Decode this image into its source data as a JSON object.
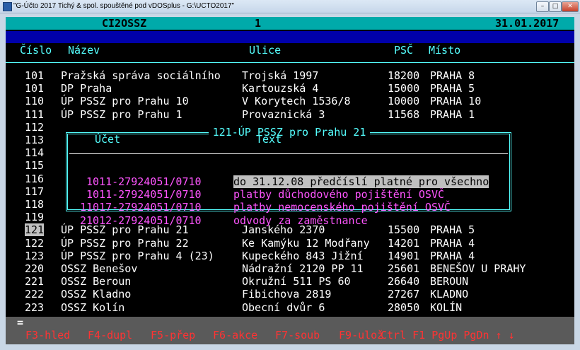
{
  "window": {
    "title": "\"G-Účto 2017 Tichý & spol. spouštěné pod vDOSplus - G:\\UCTO2017\""
  },
  "header": {
    "module": "CI2OSSZ",
    "page": "1",
    "date": "31.01.2017"
  },
  "columns": {
    "cislo": "Číslo",
    "nazev": "Název",
    "ulice": "Ulice",
    "psc": "PSČ",
    "misto": "Místo"
  },
  "rows": [
    {
      "cislo": "101",
      "nazev": "Pražská správa sociálního",
      "ulice": "Trojská 1997",
      "psc": "18200",
      "misto": "PRAHA 8"
    },
    {
      "cislo": "101",
      "nazev": "DP Praha",
      "ulice": "Kartouzská 4",
      "psc": "15000",
      "misto": "PRAHA 5"
    },
    {
      "cislo": "110",
      "nazev": "ÚP PSSZ pro Prahu 10",
      "ulice": "V Korytech 1536/8",
      "psc": "10000",
      "misto": "PRAHA 10"
    },
    {
      "cislo": "111",
      "nazev": "ÚP PSSZ pro Prahu 1",
      "ulice": "Provaznická 3",
      "psc": "11568",
      "misto": "PRAHA 1"
    },
    {
      "cislo": "112",
      "nazev": "",
      "ulice": "",
      "psc": "",
      "misto": ""
    },
    {
      "cislo": "113",
      "nazev": "",
      "ulice": "",
      "psc": "",
      "misto": ""
    },
    {
      "cislo": "114",
      "nazev": "",
      "ulice": "",
      "psc": "",
      "misto": ""
    },
    {
      "cislo": "115",
      "nazev": "",
      "ulice": "",
      "psc": "",
      "misto": ""
    },
    {
      "cislo": "116",
      "nazev": "",
      "ulice": "",
      "psc": "",
      "misto": ""
    },
    {
      "cislo": "117",
      "nazev": "",
      "ulice": "",
      "psc": "",
      "misto": ""
    },
    {
      "cislo": "118",
      "nazev": "",
      "ulice": "",
      "psc": "",
      "misto": ""
    },
    {
      "cislo": "119",
      "nazev": "",
      "ulice": "",
      "psc": "",
      "misto": ""
    },
    {
      "cislo": "121",
      "nazev": "ÚP PSSZ pro Prahu 21",
      "ulice": "Janského 2370",
      "psc": "15500",
      "misto": "PRAHA 5"
    },
    {
      "cislo": "122",
      "nazev": "ÚP PSSZ pro Prahu 22",
      "ulice": "Ke Kamýku 12 Modřany",
      "psc": "14201",
      "misto": "PRAHA 4"
    },
    {
      "cislo": "123",
      "nazev": "ÚP PSSZ pro Prahu 4 (23)",
      "ulice": "Kupeckého 843 Jižní",
      "psc": "14901",
      "misto": "PRAHA 4"
    },
    {
      "cislo": "220",
      "nazev": "OSSZ Benešov",
      "ulice": "Nádražní 2120 PP 11",
      "psc": "25601",
      "misto": "BENEŠOV U PRAHY"
    },
    {
      "cislo": "221",
      "nazev": "OSSZ Beroun",
      "ulice": "Okružní 511 PS 60",
      "psc": "26640",
      "misto": "BEROUN"
    },
    {
      "cislo": "222",
      "nazev": "OSSZ Kladno",
      "ulice": "Fibichova 2819",
      "psc": "27267",
      "misto": "KLADNO"
    },
    {
      "cislo": "223",
      "nazev": "OSSZ Kolín",
      "ulice": "Obecní dvůr 6",
      "psc": "28050",
      "misto": "KOLÍN"
    }
  ],
  "dialog": {
    "title": "121-ÚP PSSZ pro Prahu 21",
    "col_ucet": "Účet",
    "col_text": "Text",
    "items": [
      {
        "ucet": "1011-27924051/0710",
        "text": "do 31.12.08 předčíslí platné pro všechno"
      },
      {
        "ucet": "1011-27924051/0710",
        "text": "platby důchodového pojištění OSVČ"
      },
      {
        "ucet": "11017-27924051/0710",
        "text": "platby nemocenského pojištění OSVČ"
      },
      {
        "ucet": "21012-27924051/0710",
        "text": "odvody za zaměstnance"
      }
    ]
  },
  "prompt": "=",
  "fkeys": [
    {
      "key": "F3",
      "label": "-hled"
    },
    {
      "key": "F4",
      "label": "-dupl"
    },
    {
      "key": "F5",
      "label": "-přep"
    },
    {
      "key": "F6",
      "label": "-akce"
    },
    {
      "key": "F7",
      "label": "-soub"
    },
    {
      "key": "F9",
      "label": "-ulož"
    }
  ],
  "nav_keys": "Ctrl F1 PgUp PgDn ↑ ↓",
  "colors": {
    "cyan": "#55ffff",
    "magenta": "#ff55ff",
    "blue_bar": "#0000aa",
    "status_bar": "#5a5a5a",
    "header_bar": "#00aaaa"
  }
}
